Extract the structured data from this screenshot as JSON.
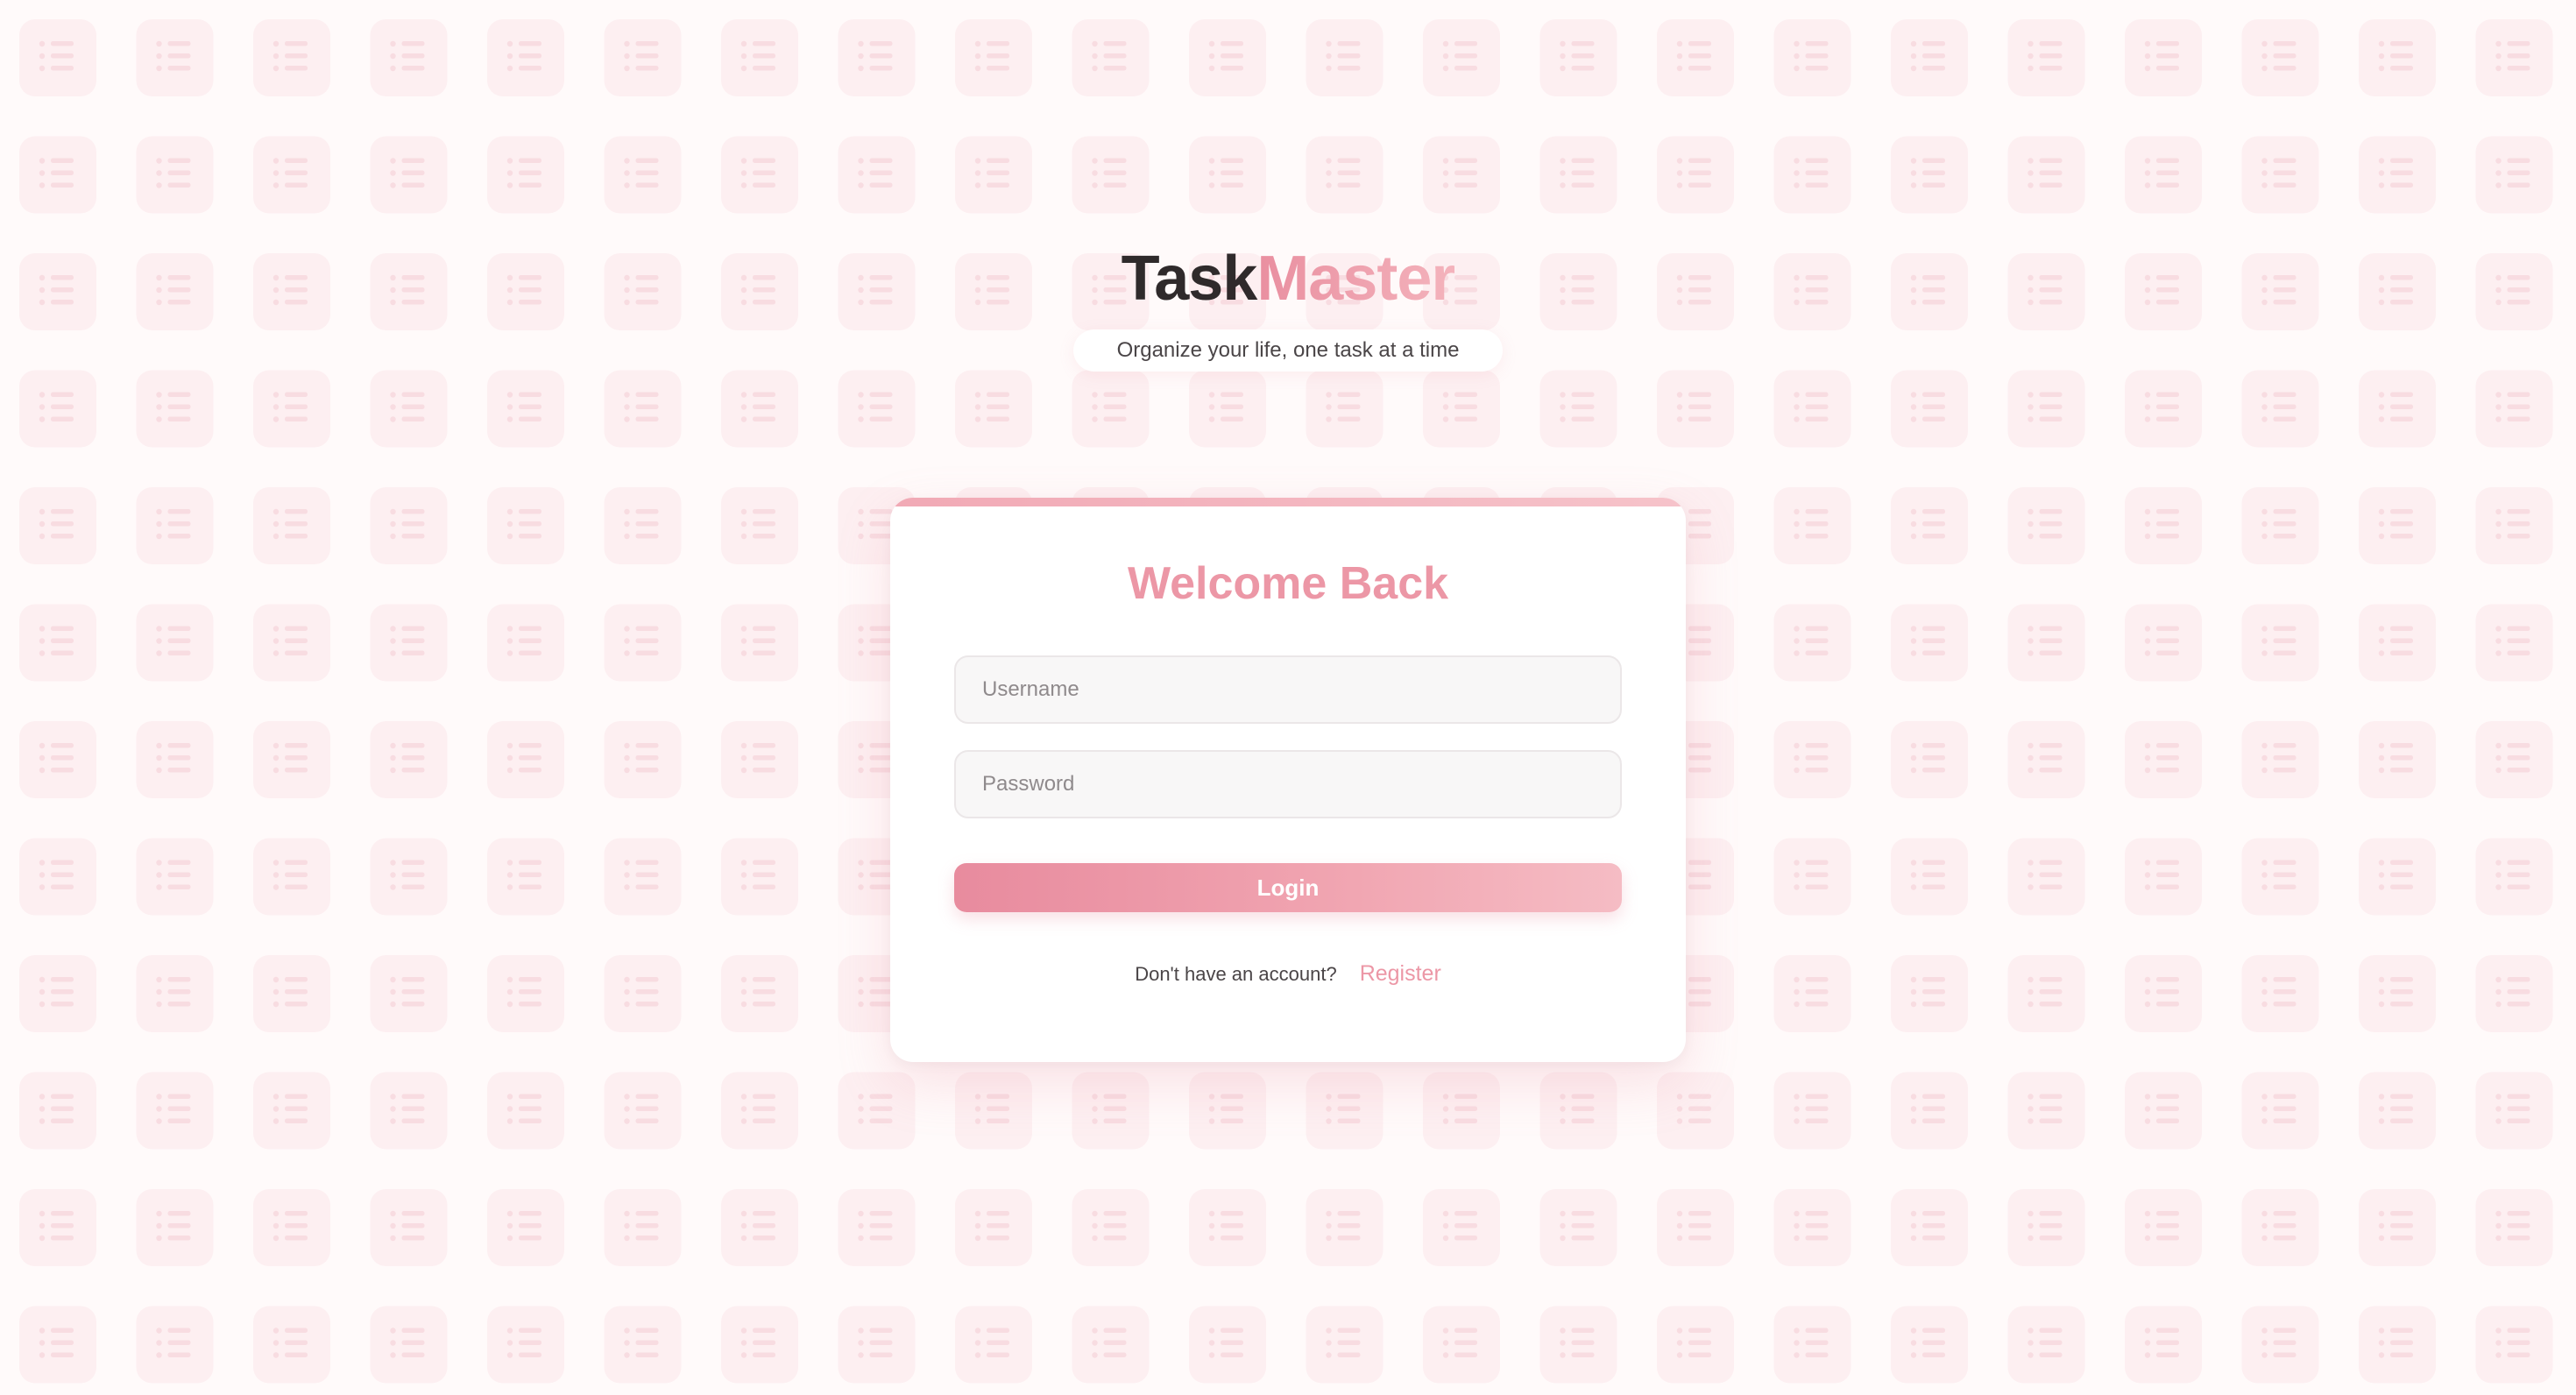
{
  "app": {
    "logo_part_1": "Task",
    "logo_part_2": "Master",
    "tagline": "Organize your life, one task at a time"
  },
  "login_card": {
    "title": "Welcome Back",
    "username": {
      "placeholder": "Username",
      "value": ""
    },
    "password": {
      "placeholder": "Password",
      "value": ""
    },
    "login_label": "Login",
    "register_prompt": "Don't have an account?",
    "register_label": "Register"
  },
  "background": {
    "icon": "list-icon"
  },
  "colors": {
    "accent": "#ec97a6",
    "accent_gradient_start": "#e88b9e",
    "accent_gradient_end": "#f5bcc4",
    "page_background": "#fffafa",
    "card_background": "#ffffff",
    "text_dark": "#2f2a2b"
  }
}
